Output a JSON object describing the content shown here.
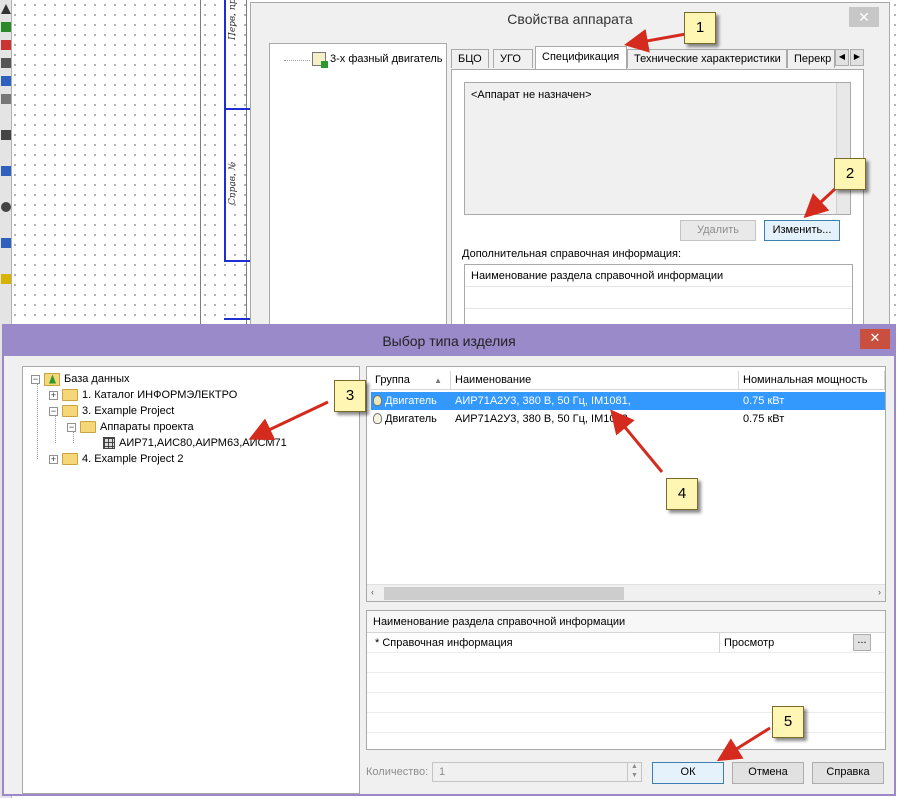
{
  "background": {
    "title_block_text_1": "Перв. примен",
    "title_block_text_2": "Справ. №"
  },
  "device_properties_dialog": {
    "title": "Свойства аппарата",
    "close_label": "✕",
    "tree_item": "3-х фазный двигатель",
    "tabs": [
      "БЦО",
      "УГО",
      "Спецификация",
      "Технические характеристики",
      "Перекр"
    ],
    "active_tab": "Спецификация",
    "spec_text": "<Аппарат не назначен>",
    "delete_button": "Удалить",
    "change_button": "Изменить...",
    "additional_info_label": "Дополнительная справочная информация:",
    "info_column": "Наименование раздела справочной информации"
  },
  "product_type_dialog": {
    "title": "Выбор типа изделия",
    "close_label": "✕",
    "tree": {
      "root": "База данных",
      "catalog": "1. Каталог ИНФОРМЭЛЕКТРО",
      "project": "3. Example Project",
      "project_devices": "Аппараты проекта",
      "device_series": "АИР71,АИС80,АИРМ63,АИСМ71",
      "project2": "4. Example Project 2"
    },
    "list_columns": [
      "Группа",
      "Наименование",
      "Номинальная мощность"
    ],
    "rows": [
      {
        "group": "Двигатель",
        "name": "АИР71А2У3, 380 В, 50 Гц, IM1081,",
        "power": "0.75 кВт",
        "selected": true
      },
      {
        "group": "Двигатель",
        "name": "АИР71А2У3, 380 В, 50 Гц, IM1082,",
        "power": "0.75 кВт",
        "selected": false
      }
    ],
    "info_header": "Наименование раздела справочной информации",
    "info_row_label": "* Справочная информация",
    "info_row_value": "Просмотр",
    "info_row_button": "...",
    "quantity_label": "Количество:",
    "quantity_value": "1",
    "ok_button": "ОК",
    "cancel_button": "Отмена",
    "help_button": "Справка"
  },
  "callouts": [
    "1",
    "2",
    "3",
    "4",
    "5"
  ],
  "colors": {
    "selection": "#3399ff",
    "callout_fill": "#fff6b3",
    "arrow": "#d42b1e",
    "frame_blue": "#1e2fd1",
    "dialog2_titlebar": "#9b8ac9"
  }
}
